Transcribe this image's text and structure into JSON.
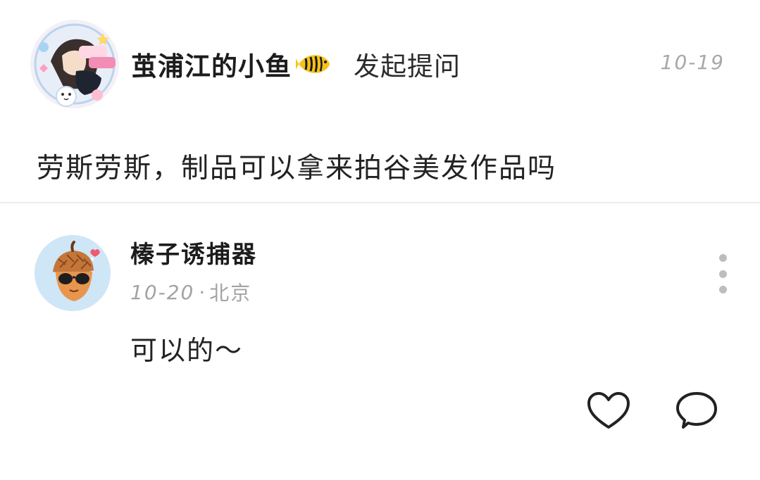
{
  "question": {
    "author_name": "茧浦江的小鱼",
    "author_badge_icon": "tropical-fish-icon",
    "action_label": "发起提问",
    "date": "10-19",
    "text": "劳斯劳斯，制品可以拿来拍谷美发作品吗"
  },
  "answer": {
    "author_name": "榛子诱捕器",
    "date": "10-20",
    "separator": "·",
    "location": "北京",
    "text": "可以的～",
    "more_icon": "more-vertical-icon",
    "like_icon": "heart-icon",
    "comment_icon": "comment-bubble-icon"
  },
  "colors": {
    "avatar_bg_answer": "#cfe6f7",
    "meta_text": "#a3a3a3",
    "divider": "#ececec",
    "icon_stroke": "#222222"
  }
}
